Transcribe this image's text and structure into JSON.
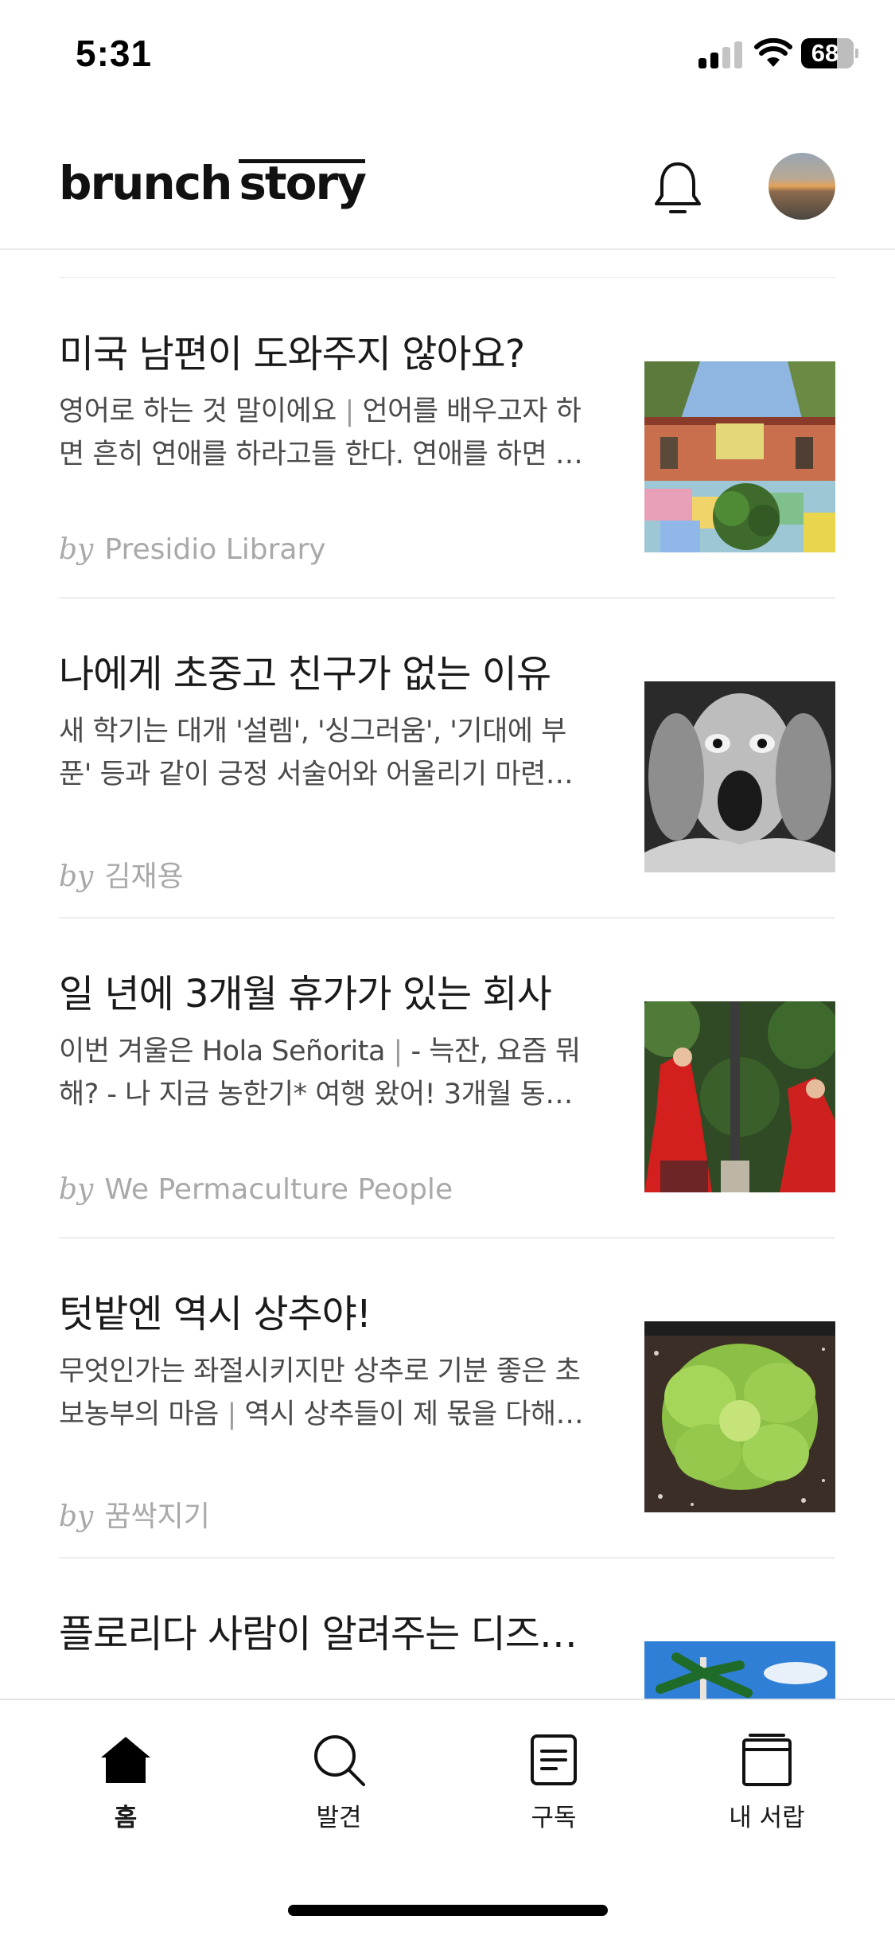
{
  "status_bar": {
    "time": "5:31",
    "battery": "68",
    "icons": [
      "cellular-signal-icon",
      "wifi-icon",
      "battery-icon"
    ]
  },
  "header": {
    "logo_part1": "brunch",
    "logo_part2": "story",
    "icons": [
      "bell-icon",
      "profile-avatar"
    ]
  },
  "articles": [
    {
      "title": "미국 남편이 도와주지 않아요?",
      "excerpt_lead": "영어로 하는 것 말이에요",
      "excerpt_sep": " | ",
      "excerpt_rest": "언어를 배우고자 하면 흔히 연애를 하라고들 한다. 연애를 하면 자연스럽게 영어를 쓰게 된다고",
      "by": "by",
      "author": "Presidio Library",
      "image": "colorful-courtyard-photo"
    },
    {
      "title": "나에게 초중고 친구가 없는 이유",
      "excerpt_lead": "",
      "excerpt_sep": "",
      "excerpt_rest": "새 학기는 대개 '설렘', '싱그러움', '기대에 부푼' 등과 같이 긍정 서술어와 어울리기 마련이지만",
      "by": "by",
      "author": "김재용",
      "image": "screaming-man-photo"
    },
    {
      "title": "일 년에 3개월 휴가가 있는 회사",
      "excerpt_lead": "이번 겨울은 Hola Señorita",
      "excerpt_sep": " | ",
      "excerpt_rest": "- 늑잔, 요즘 뭐 해? - 나 지금 농한기* 여행 왔어! 3개월 동안의 긴 휴가를",
      "by": "by",
      "author": "We Permaculture People",
      "image": "flamenco-dancers-photo"
    },
    {
      "title": "텃밭엔 역시 상추야!",
      "excerpt_lead": "무엇인가는 좌절시키지만 상추로 기분 좋은 초보농부의 마음",
      "excerpt_sep": " | ",
      "excerpt_rest": "역시 상추들이 제 몫을 다해주고 있다",
      "by": "by",
      "author": "꿈싹지기",
      "image": "lettuce-photo"
    },
    {
      "title": "플로리다 사람이 알려주는 디즈니월드",
      "excerpt_lead": "",
      "excerpt_sep": "",
      "excerpt_rest": "",
      "by": "",
      "author": "",
      "image": "palm-tree-photo"
    }
  ],
  "tabbar": {
    "tabs": [
      {
        "label": "홈",
        "icon": "home-icon",
        "active": true
      },
      {
        "label": "발견",
        "icon": "search-icon",
        "active": false
      },
      {
        "label": "구독",
        "icon": "document-icon",
        "active": false
      },
      {
        "label": "내 서랍",
        "icon": "drawer-icon",
        "active": false
      }
    ]
  }
}
